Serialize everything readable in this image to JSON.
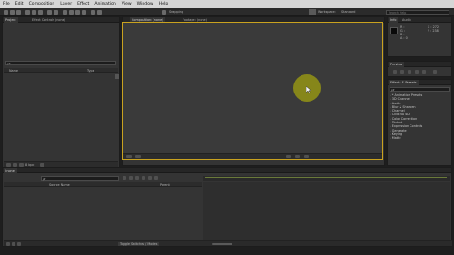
{
  "menu": [
    "File",
    "Edit",
    "Composition",
    "Layer",
    "Effect",
    "Animation",
    "View",
    "Window",
    "Help"
  ],
  "toolbar": {
    "snapping_label": "Snapping",
    "workspace_label": "Workspace:",
    "workspace_value": "Standard",
    "search_placeholder": "Search Help"
  },
  "project_panel": {
    "tab": "Project",
    "tab2": "Effect Controls (none)",
    "search_value": "ρ▾",
    "col_name": "Name",
    "col_type": "Type",
    "footer_bpc": "8 bpc"
  },
  "composition_panel": {
    "tab": "Composition: (none)",
    "tab2": "Footage: (none)"
  },
  "info_panel": {
    "tab": "Info",
    "tab2": "Audio",
    "r": "R :",
    "g": "G :",
    "b": "B :",
    "a": "A : 0",
    "x": "X : 272",
    "y": "Y : 238"
  },
  "preview_panel": {
    "tab": "Preview"
  },
  "effects_panel": {
    "tab": "Effects & Presets",
    "search_value": "ρ▾",
    "items": [
      "* Animation Presets",
      "3D Channel",
      "Audio",
      "Blur & Sharpen",
      "Channel",
      "CINEMA 4D",
      "Color Correction",
      "Distort",
      "Expression Controls",
      "Generate",
      "Keying",
      "Matte"
    ]
  },
  "timeline": {
    "tab": "(none)",
    "search_value": "ρ▾",
    "col_source": "Source Name",
    "col_parent": "Parent",
    "toggle_label": "Toggle Switches / Modes"
  },
  "colors": {
    "accent": "#c9a21f",
    "cursor_halo": "#8a8a18",
    "menubar": "#d6d6d6"
  }
}
